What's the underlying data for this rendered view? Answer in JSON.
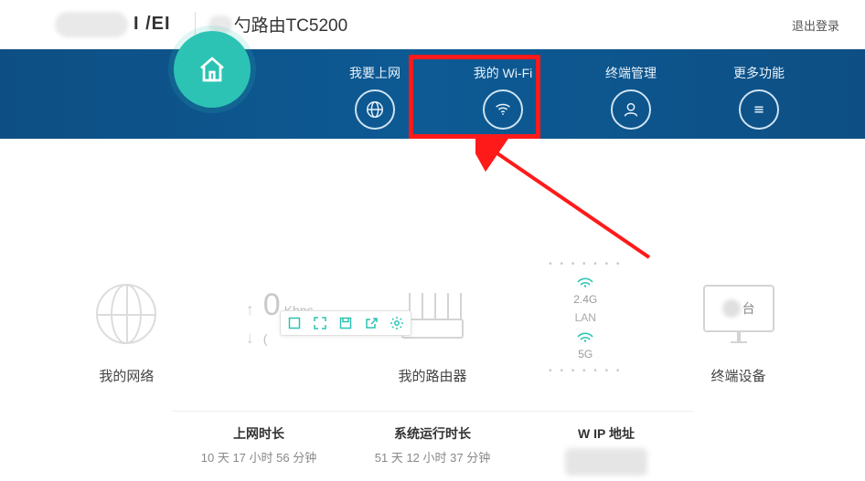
{
  "header": {
    "brand_partial": "I    /EI",
    "model_suffix": "勺路由TC5200",
    "logout": "退出登录"
  },
  "nav": {
    "home": "主页",
    "internet": "我要上网",
    "wifi": "我的 Wi-Fi",
    "devices": "终端管理",
    "more": "更多功能"
  },
  "dash": {
    "network_label": "我的网络",
    "router_label": "我的路由器",
    "devices_label": "终端设备",
    "speed_up_value": "0",
    "speed_up_unit": "Kbps",
    "speed_down_symbol": "(",
    "wifi": {
      "band24": "2.4G",
      "lan": "LAN",
      "band5": "5G"
    },
    "device_unit": "台"
  },
  "info": {
    "uptime_online_title": "上网时长",
    "uptime_online_value": "10 天 17 小时 56 分钟",
    "uptime_sys_title": "系统运行时长",
    "uptime_sys_value": "51 天 12 小时 37 分钟",
    "ip_title_partial": "W      IP 地址"
  }
}
